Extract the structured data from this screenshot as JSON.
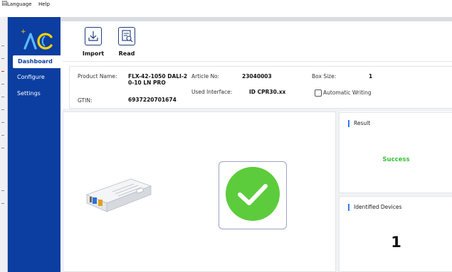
{
  "menu": {
    "items": [
      "Language",
      "Help"
    ]
  },
  "sidebar": {
    "items": [
      {
        "label": "Dashboard",
        "active": true
      },
      {
        "label": "Configure",
        "active": false
      },
      {
        "label": "Settings",
        "active": false
      }
    ]
  },
  "toolbar": {
    "import_label": "Import",
    "read_label": "Read"
  },
  "info": {
    "product_name_label": "Product Name:",
    "product_name_line1": "FLX-42-1050 DALI-2",
    "product_name_line2": "0-10 LN PRO",
    "gtin_label": "GTIN:",
    "gtin_value": "6937220701674",
    "article_label": "Article No:",
    "article_value": "23040003",
    "interface_label": "Used Interface:",
    "interface_value": "ID CPR30.xx",
    "box_size_label": "Box Size:",
    "box_size_value": "1",
    "auto_writing_label": "Automatic Writing",
    "auto_writing_checked": false
  },
  "result": {
    "title": "Result",
    "status": "Success",
    "status_color": "#3cbf3c"
  },
  "identified": {
    "title": "Identified Devices",
    "count": "1"
  },
  "colors": {
    "sidebar": "#0b3ea0",
    "accent": "#2f7cf6",
    "success": "#5ccc3c"
  }
}
